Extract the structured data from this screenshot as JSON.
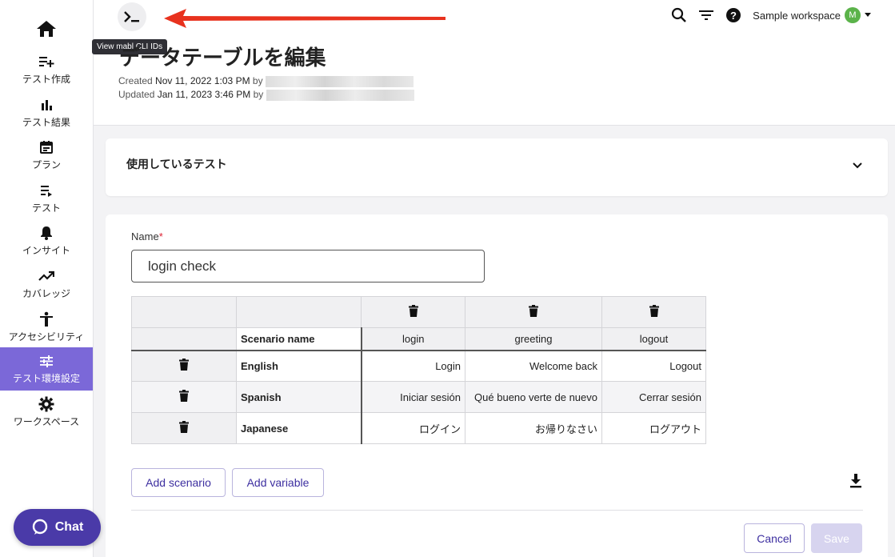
{
  "sidebar": {
    "items": [
      {
        "label": "テスト作成",
        "icon": "playlist-add-icon"
      },
      {
        "label": "テスト結果",
        "icon": "bar-chart-icon"
      },
      {
        "label": "プラン",
        "icon": "calendar-icon"
      },
      {
        "label": "テスト",
        "icon": "list-play-icon"
      },
      {
        "label": "インサイト",
        "icon": "bell-icon"
      },
      {
        "label": "カバレッジ",
        "icon": "trending-up-icon"
      },
      {
        "label": "アクセシビリティ",
        "icon": "accessibility-icon"
      },
      {
        "label": "テスト環境設定",
        "icon": "sliders-icon"
      },
      {
        "label": "ワークスペース",
        "icon": "gear-icon"
      }
    ],
    "active_index": 7,
    "chat_label": "Chat"
  },
  "header": {
    "tooltip": "View mabl CLI IDs",
    "title": "データテーブルを編集",
    "created_prefix": "Created",
    "created_value": "Nov 11, 2022 1:03 PM",
    "updated_prefix": "Updated",
    "updated_value": "Jan 11, 2023 3:46 PM",
    "by_label": "by",
    "workspace": "Sample workspace",
    "avatar_letter": "M"
  },
  "used_tests": {
    "title": "使用しているテスト"
  },
  "form": {
    "name_label": "Name",
    "name_required": "*",
    "name_value": "login check"
  },
  "table": {
    "scenario_header": "Scenario name",
    "columns": [
      "login",
      "greeting",
      "logout"
    ],
    "rows": [
      {
        "name": "English",
        "values": [
          "Login",
          "Welcome back",
          "Logout"
        ]
      },
      {
        "name": "Spanish",
        "values": [
          "Iniciar sesión",
          "Qué bueno verte de nuevo",
          "Cerrar sesión"
        ]
      },
      {
        "name": "Japanese",
        "values": [
          "ログイン",
          "お帰りなさい",
          "ログアウト"
        ]
      }
    ]
  },
  "buttons": {
    "add_scenario": "Add scenario",
    "add_variable": "Add variable",
    "cancel": "Cancel",
    "save": "Save"
  },
  "colors": {
    "accent": "#7b68d8",
    "primary": "#4a3aa8",
    "annotation": "#e8321e"
  }
}
